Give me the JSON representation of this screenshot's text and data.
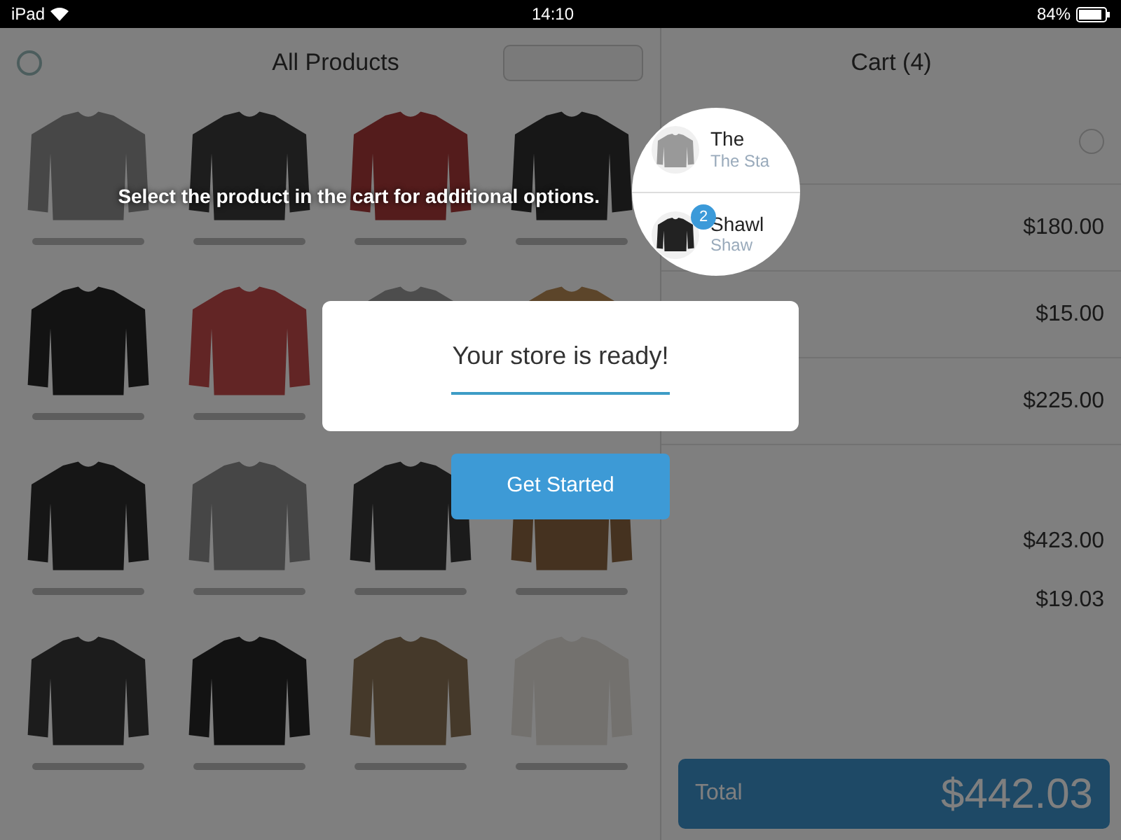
{
  "status_bar": {
    "device": "iPad",
    "time": "14:10",
    "battery": "84%"
  },
  "products_panel": {
    "title": "All Products"
  },
  "cart": {
    "title": "Cart (4)",
    "items": [
      {
        "price": "$180.00"
      },
      {
        "price": "$15.00"
      },
      {
        "price": "$225.00"
      }
    ],
    "totals": [
      {
        "amount": "$423.00"
      },
      {
        "amount": "$19.03"
      }
    ],
    "total": {
      "label": "Total",
      "amount": "$442.03"
    }
  },
  "coach": {
    "tip": "Select the product in the cart for additional options.",
    "magnified_items": [
      {
        "title": "The",
        "subtitle": "The Sta"
      },
      {
        "title": "Shawl",
        "subtitle": "Shaw",
        "badge": "2"
      }
    ],
    "message": "Your store is ready!",
    "button": "Get Started"
  }
}
